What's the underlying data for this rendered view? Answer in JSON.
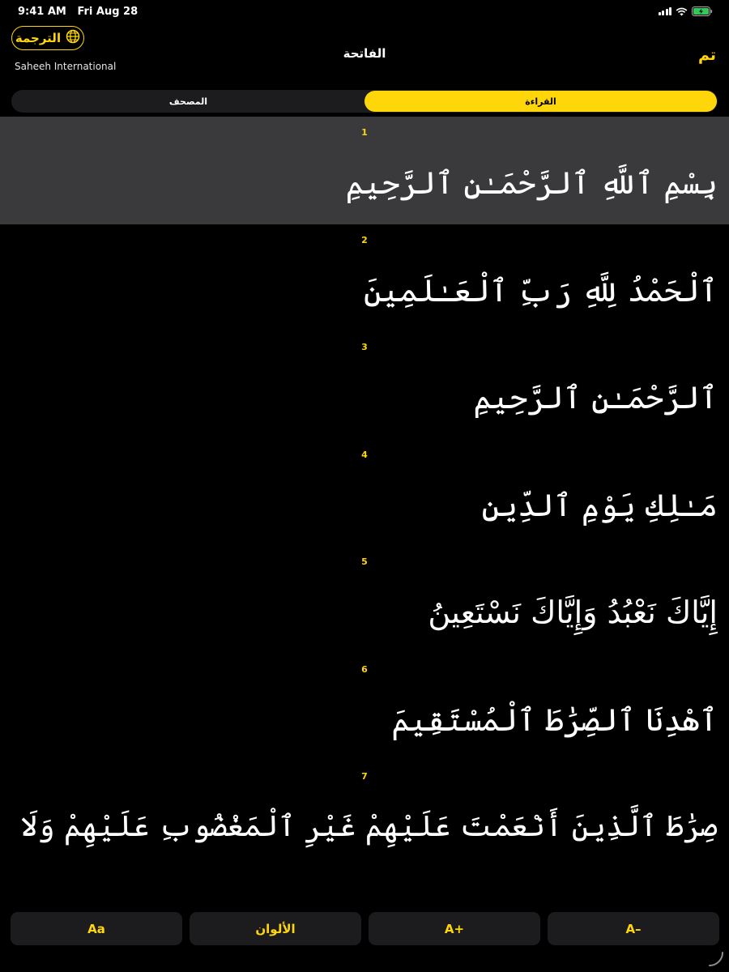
{
  "status_bar": {
    "time": "9:41 AM",
    "date": "Fri Aug 28"
  },
  "header": {
    "translation_button_label": "الترجمة",
    "translation_icon": "globe-icon",
    "translator_name": "Saheeh International",
    "title": "الفاتحة",
    "done_label": "تم"
  },
  "segments": {
    "mushaf_label": "المصحف",
    "reading_label": "القراءة",
    "selected": "reading"
  },
  "verses": [
    {
      "number": "1",
      "text": "بِسْمِ ٱللَّهِ ٱلرَّحْمَـٰنِ ٱلرَّحِيمِ"
    },
    {
      "number": "2",
      "text": "ٱلْحَمْدُ لِلَّهِ رَبِّ ٱلْعَـٰلَمِينَ"
    },
    {
      "number": "3",
      "text": "ٱلرَّحْمَـٰنِ ٱلرَّحِيمِ"
    },
    {
      "number": "4",
      "text": "مَـٰلِكِ يَوْمِ ٱلدِّينِ"
    },
    {
      "number": "5",
      "text": "إِيَّاكَ نَعْبُدُ وَإِيَّاكَ نَسْتَعِينُ"
    },
    {
      "number": "6",
      "text": "ٱهْدِنَا ٱلصِّرَٰطَ ٱلْمُسْتَقِيمَ"
    },
    {
      "number": "7",
      "text": "صِرَٰطَ ٱلَّذِينَ أَنْعَمْتَ عَلَيْهِمْ غَيْرِ ٱلْمَغْضُوبِ عَلَيْهِمْ وَلَا ٱلضَّآلِّينَ"
    }
  ],
  "highlighted_verse": "1",
  "toolbar": {
    "font_label": "Aa",
    "colors_label": "الألوان",
    "increase_label": "A+",
    "decrease_label": "A–"
  },
  "colors": {
    "accent": "#FFD60A",
    "background": "#000000",
    "highlight": "#3a3a3c",
    "control": "#1c1c1e"
  }
}
